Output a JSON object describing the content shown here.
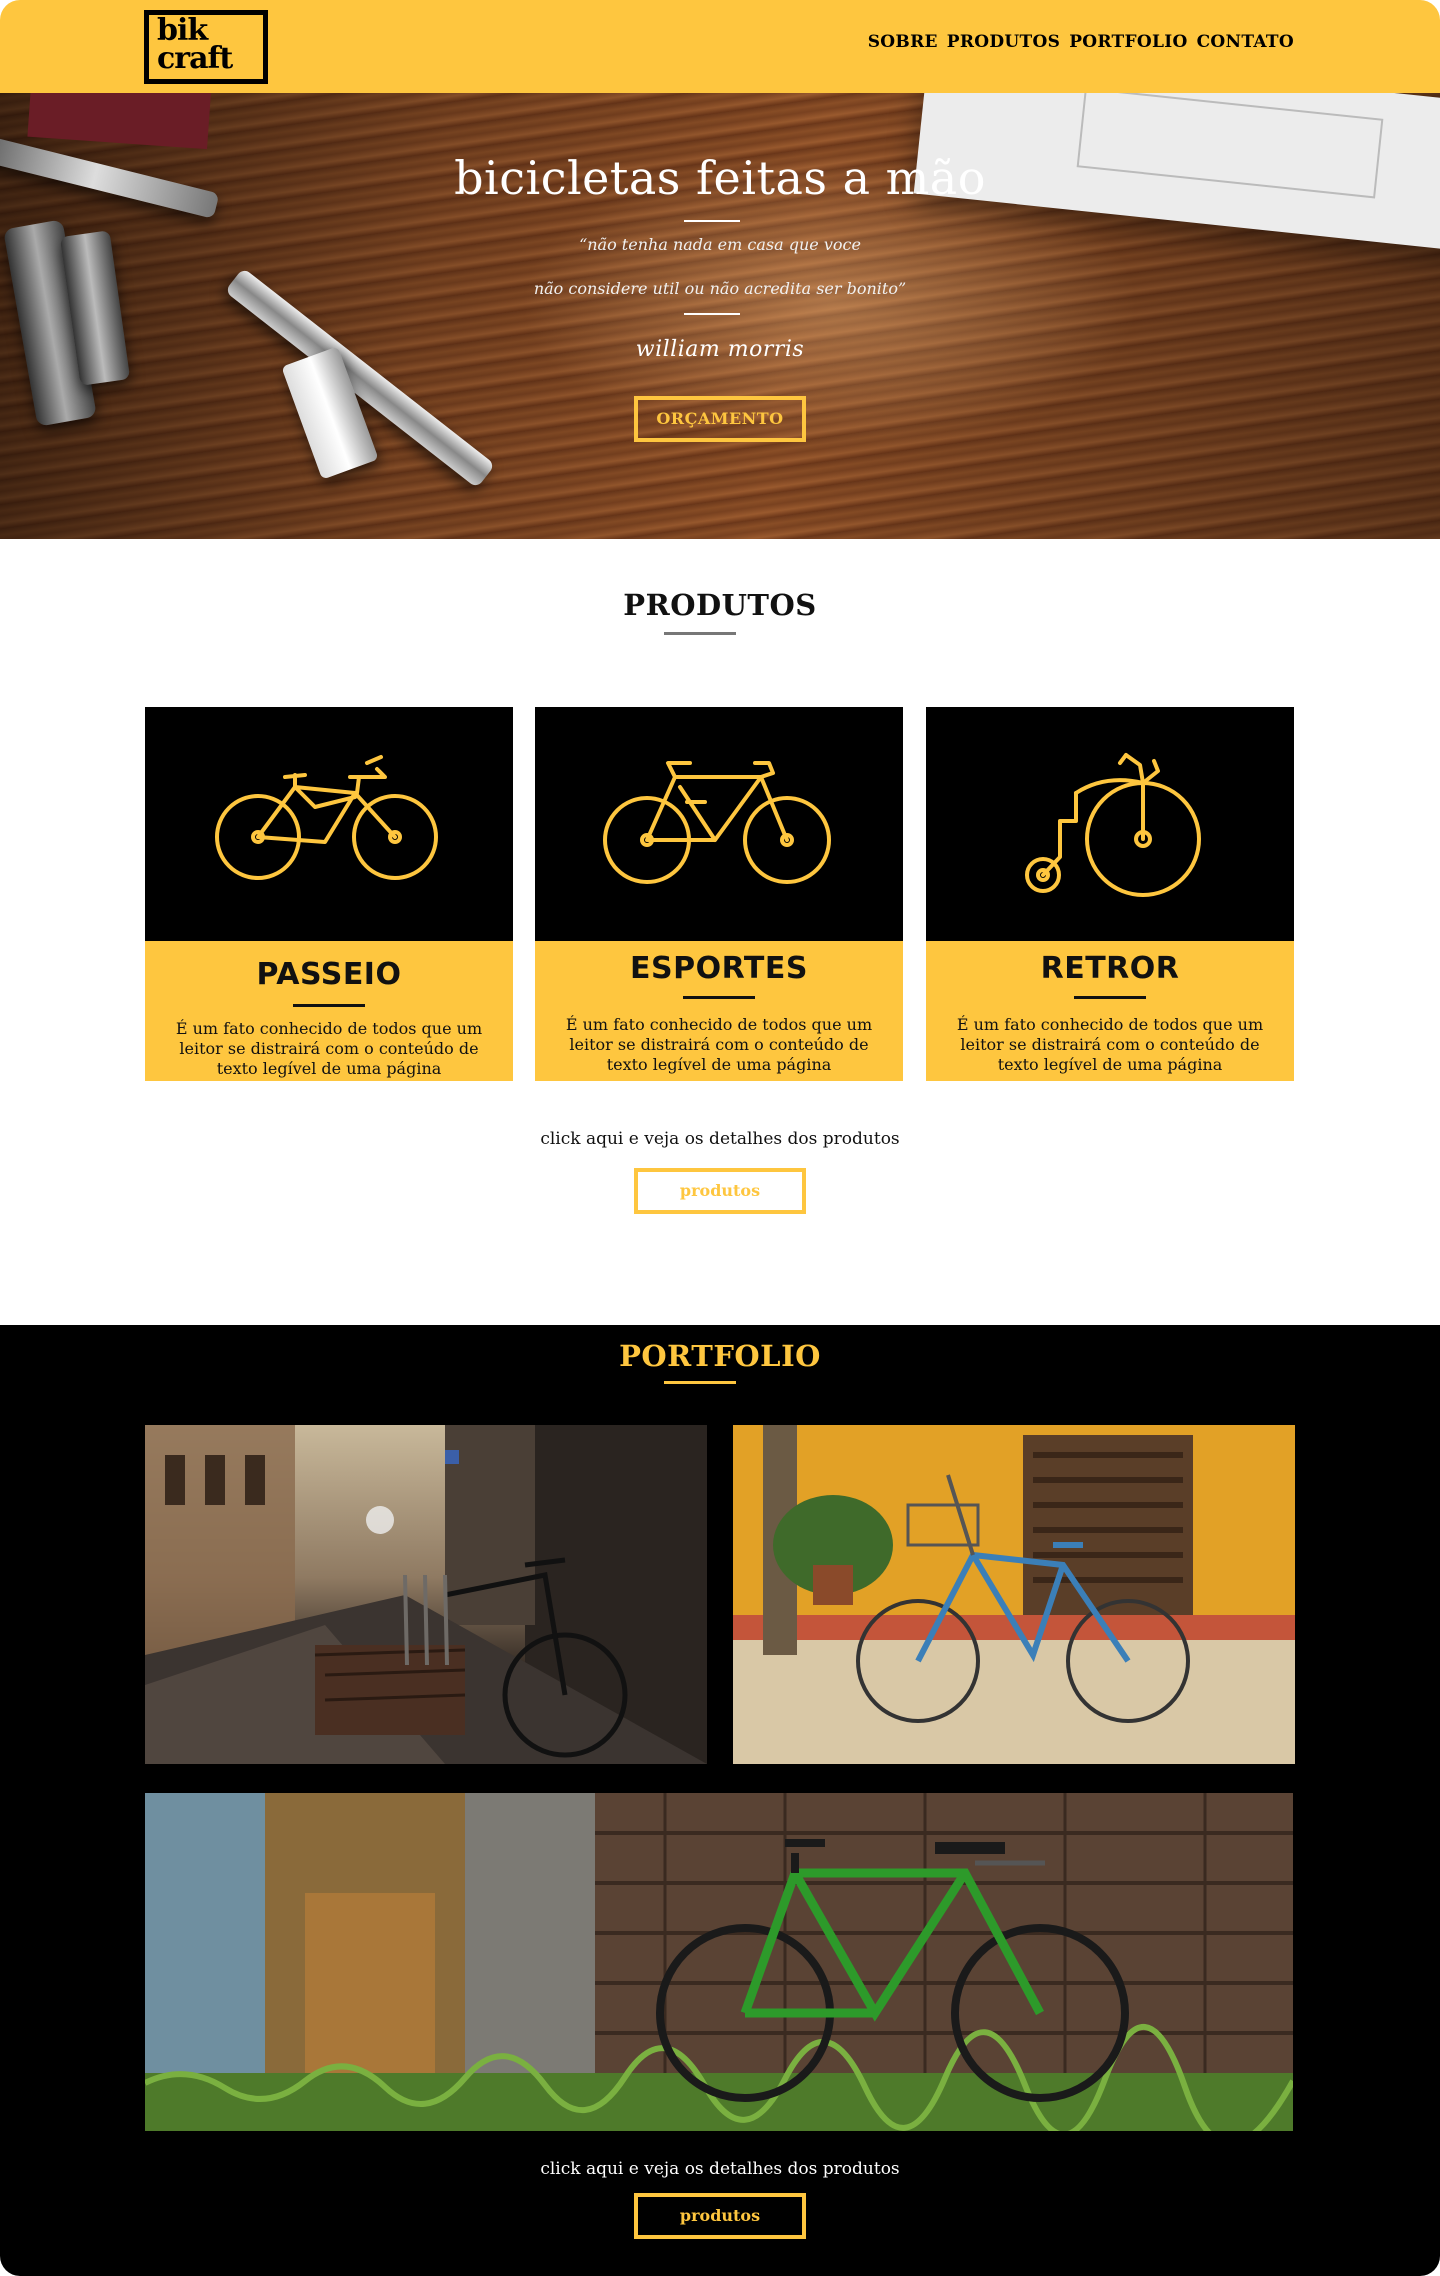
{
  "brand": {
    "logo_line1": "bik",
    "logo_line2": "craft",
    "accent": "#FEC63F"
  },
  "nav": {
    "items": [
      "SOBRE",
      "PRODUTOS",
      "PORTFOLIO",
      "CONTATO"
    ]
  },
  "hero": {
    "title": "bicicletas feitas a mão",
    "quote_line1": "“não tenha nada em casa que voce",
    "quote_line2": "não considere util ou não acredita ser bonito”",
    "author": "william morris",
    "button": "ORÇAMENTO"
  },
  "produtos": {
    "title": "PRODUTOS",
    "cards": [
      {
        "name": "PASSEIO",
        "icon": "cruiser-bike-icon",
        "desc": "É um fato conhecido de todos que um leitor se distrairá com o conteúdo de texto legível de uma página"
      },
      {
        "name": "ESPORTES",
        "icon": "road-bike-icon",
        "desc": "É um fato conhecido de todos que um leitor se distrairá com o conteúdo de texto legível de uma página"
      },
      {
        "name": "RETROR",
        "icon": "penny-farthing-icon",
        "desc": "É um fato conhecido de todos que um leitor se distrairá com o conteúdo de texto legível de uma página"
      }
    ],
    "cta_text": "click aqui e veja os detalhes dos produtos",
    "cta_button": "produtos"
  },
  "portfolio": {
    "title": "PORTFOLIO",
    "cta_text": "click aqui e veja os detalhes dos produtos",
    "cta_button": "produtos"
  }
}
